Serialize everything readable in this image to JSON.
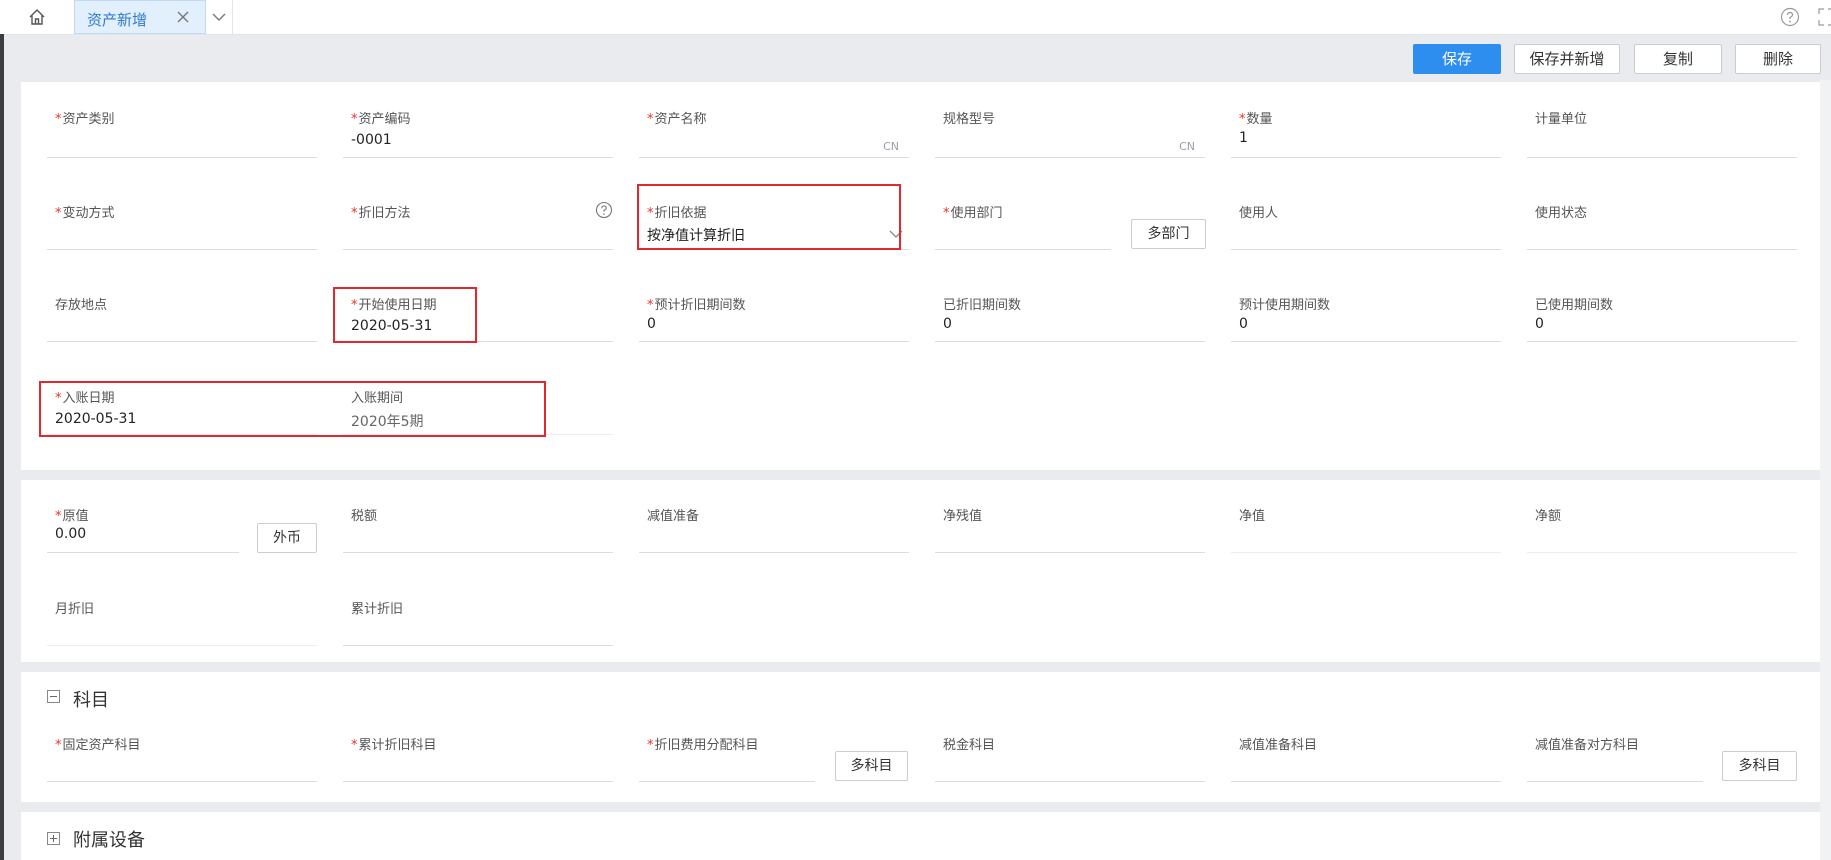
{
  "tabs": {
    "active_label": "资产新增"
  },
  "toolbar": {
    "save": "保存",
    "save_new": "保存并新增",
    "copy": "复制",
    "delete": "删除"
  },
  "basic": {
    "asset_category": {
      "label": "资产类别",
      "value": ""
    },
    "asset_code": {
      "label": "资产编码",
      "value": "-0001"
    },
    "asset_name": {
      "label": "资产名称",
      "value": "",
      "suffix": "CN"
    },
    "spec_model": {
      "label": "规格型号",
      "value": "",
      "suffix": "CN"
    },
    "quantity": {
      "label": "数量",
      "value": "1"
    },
    "unit": {
      "label": "计量单位",
      "value": ""
    },
    "change_method": {
      "label": "变动方式",
      "value": ""
    },
    "depr_method": {
      "label": "折旧方法",
      "value": ""
    },
    "depr_basis": {
      "label": "折旧依据",
      "value": "按净值计算折旧"
    },
    "dept": {
      "label": "使用部门",
      "value": "",
      "button": "多部门"
    },
    "user": {
      "label": "使用人",
      "value": ""
    },
    "use_status": {
      "label": "使用状态",
      "value": ""
    },
    "location": {
      "label": "存放地点",
      "value": ""
    },
    "start_date": {
      "label": "开始使用日期",
      "value": "2020-05-31"
    },
    "est_depr_periods": {
      "label": "预计折旧期间数",
      "value": "0"
    },
    "depr_periods": {
      "label": "已折旧期间数",
      "value": "0"
    },
    "est_use_periods": {
      "label": "预计使用期间数",
      "value": "0"
    },
    "used_periods": {
      "label": "已使用期间数",
      "value": "0"
    },
    "post_date": {
      "label": "入账日期",
      "value": "2020-05-31"
    },
    "post_period": {
      "label": "入账期间",
      "value": "2020年5期"
    }
  },
  "values": {
    "original": {
      "label": "原值",
      "value": "0.00",
      "button": "外币"
    },
    "tax": {
      "label": "税额",
      "value": ""
    },
    "impairment": {
      "label": "减值准备",
      "value": ""
    },
    "net_residual": {
      "label": "净残值",
      "value": ""
    },
    "net_value": {
      "label": "净值",
      "value": ""
    },
    "net_amount": {
      "label": "净额",
      "value": ""
    },
    "monthly_depr": {
      "label": "月折旧",
      "value": ""
    },
    "accum_depr": {
      "label": "累计折旧",
      "value": ""
    }
  },
  "accounts": {
    "title": "科目",
    "fixed_asset": {
      "label": "固定资产科目",
      "value": ""
    },
    "accum_depr": {
      "label": "累计折旧科目",
      "value": ""
    },
    "depr_alloc": {
      "label": "折旧费用分配科目",
      "value": "",
      "button": "多科目"
    },
    "tax": {
      "label": "税金科目",
      "value": ""
    },
    "impairment": {
      "label": "减值准备科目",
      "value": ""
    },
    "impairment_contra": {
      "label": "减值准备对方科目",
      "value": "",
      "button": "多科目"
    }
  },
  "attached": {
    "title": "附属设备"
  },
  "colors": {
    "primary": "#2d8ef0",
    "required": "#e8312b",
    "highlight": "#e0282e",
    "tab_bg": "#e2effc"
  }
}
